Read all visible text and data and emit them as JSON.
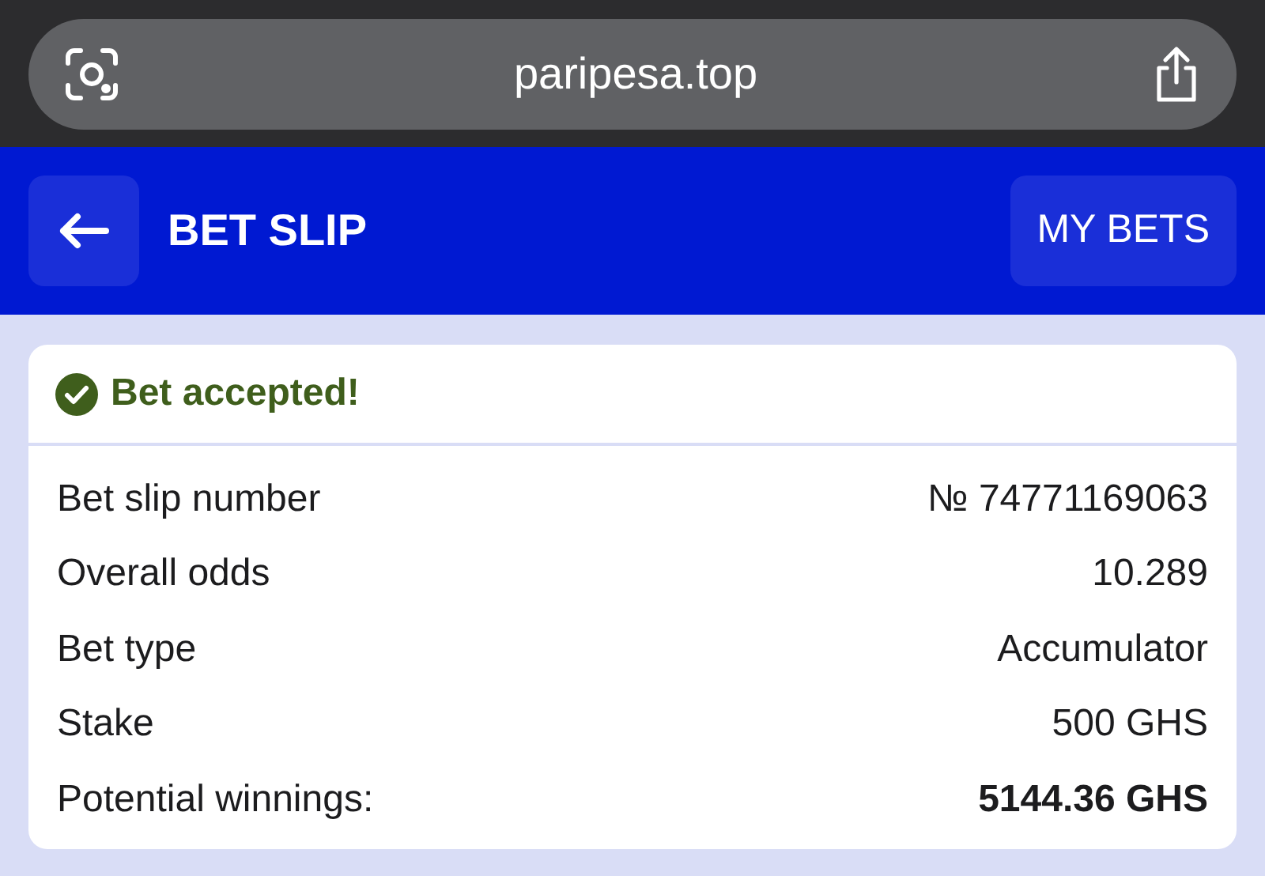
{
  "address_bar": {
    "url": "paripesa.top"
  },
  "header": {
    "title": "BET SLIP",
    "my_bets_button": "MY BETS"
  },
  "status": {
    "message": "Bet accepted!"
  },
  "details": [
    {
      "kind": "detail",
      "label": "Bet slip number",
      "value": "№ 74771169063"
    },
    {
      "kind": "detail",
      "label": "Overall odds",
      "value": "10.289"
    },
    {
      "kind": "detail",
      "label": "Bet type",
      "value": "Accumulator"
    },
    {
      "kind": "detail",
      "label": "Stake",
      "value": "500 GHS"
    },
    {
      "kind": "total",
      "label": "Potential winnings:",
      "value": "5144.36 GHS"
    }
  ]
}
